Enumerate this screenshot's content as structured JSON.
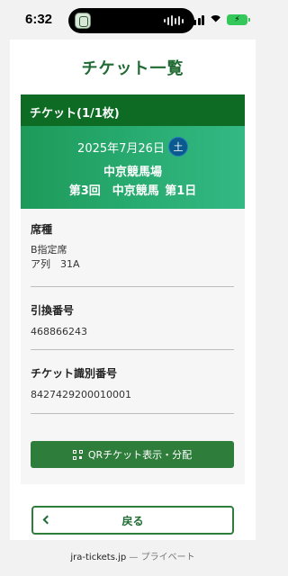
{
  "status_bar": {
    "time": "6:32",
    "battery_icon": "battery-charging-icon"
  },
  "page": {
    "title": "チケット一覧",
    "ticket_header": "チケット(1/1枚)",
    "event": {
      "date": "2025年7月26日",
      "weekday": "土",
      "venue": "中京競馬場",
      "meeting": "第3回　中京競馬 第1日"
    },
    "details": {
      "seat_label": "席種",
      "seat_type": "B指定席",
      "seat_position": "ア列　31A",
      "exchange_label": "引換番号",
      "exchange_number": "468866243",
      "ticket_id_label": "チケット識別番号",
      "ticket_id": "8427429200010001"
    },
    "qr_button_label": "QRチケット表示・分配",
    "back_button_label": "戻る"
  },
  "browser": {
    "domain": "jra-tickets.jp",
    "privacy": "— プライベート"
  },
  "colors": {
    "brand_green": "#0d6b24",
    "title_green": "#1f6b33",
    "badge_blue": "#0a5a8f"
  }
}
